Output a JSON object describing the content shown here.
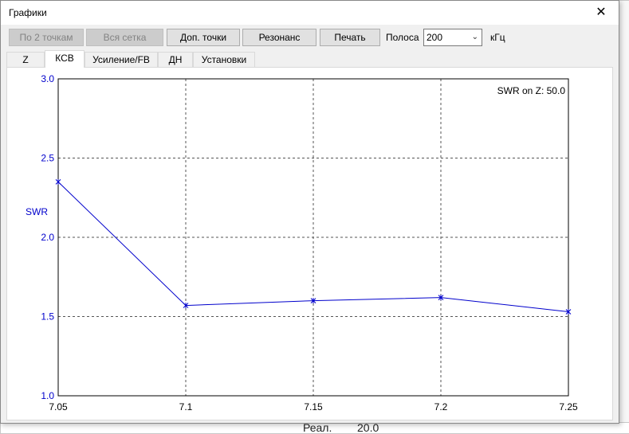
{
  "window": {
    "title": "Графики",
    "close_glyph": "✕"
  },
  "toolbar": {
    "buttons": [
      {
        "label": "По 2 точкам",
        "enabled": false
      },
      {
        "label": "Вся сетка",
        "enabled": false
      },
      {
        "label": "Доп. точки",
        "enabled": true
      },
      {
        "label": "Резонанс",
        "enabled": true
      },
      {
        "label": "Печать",
        "enabled": true
      }
    ],
    "band_label": "Полоса",
    "band_value": "200",
    "band_unit": "кГц"
  },
  "tabs": [
    {
      "label": "Z",
      "active": false
    },
    {
      "label": "КСВ",
      "active": true
    },
    {
      "label": "Усиление/FB",
      "active": false
    },
    {
      "label": "ДН",
      "active": false
    },
    {
      "label": "Установки",
      "active": false
    }
  ],
  "background": {
    "fragment_text": "Реал.",
    "fragment_value": "20.0"
  },
  "chart_data": {
    "type": "line",
    "ylabel": "SWR",
    "annotation": "SWR on Z: 50.0",
    "xlim": [
      7.05,
      7.25
    ],
    "ylim": [
      1.0,
      3.0
    ],
    "x_ticks": [
      "7.05",
      "7.1",
      "7.15",
      "7.2",
      "7.25"
    ],
    "y_ticks": [
      "1.0",
      "1.5",
      "2.0",
      "2.5",
      "3.0"
    ],
    "grid": true,
    "series": [
      {
        "x": [
          7.05,
          7.1,
          7.15,
          7.2,
          7.25
        ],
        "y": [
          2.35,
          1.57,
          1.6,
          1.62,
          1.53
        ],
        "color": "#0000cc"
      }
    ],
    "axis_label_color": "#0000cc"
  }
}
